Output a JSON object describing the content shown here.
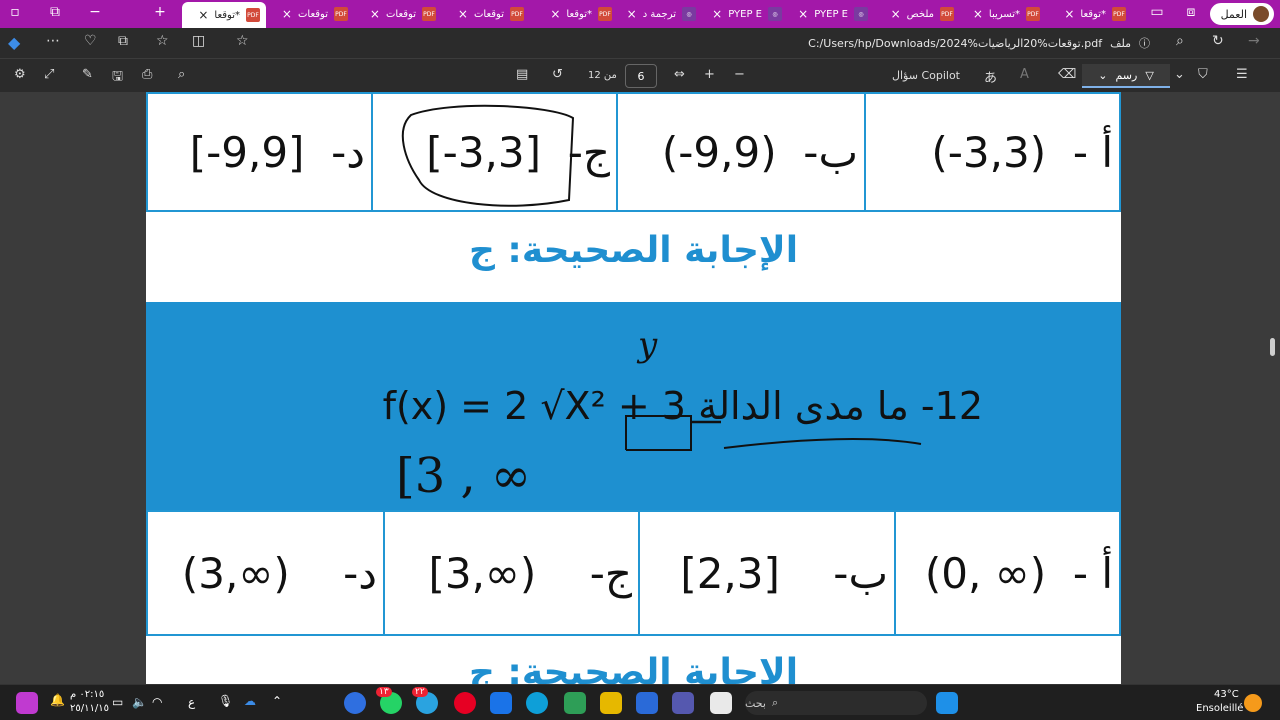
{
  "tabs": [
    {
      "label": "*توقعا",
      "active": true
    },
    {
      "label": "توقعات"
    },
    {
      "label": "توقعات"
    },
    {
      "label": "توقعات"
    },
    {
      "label": "*توقعا"
    },
    {
      "label": "ترجمة د"
    },
    {
      "label": "PYEP E"
    },
    {
      "label": "PYEP E"
    },
    {
      "label": "ملخص"
    },
    {
      "label": "*تسريبا"
    },
    {
      "label": "*توقعا"
    }
  ],
  "profile": {
    "label": "العمل"
  },
  "address": {
    "path": "C:/Users/hp/Downloads/2024%توقعات%20الرياضيات.pdf",
    "file_label": "ملف"
  },
  "pdf_toolbar": {
    "page": "6",
    "of_total": "من 12",
    "copilot": "سؤال Copilot",
    "draw": "رسم"
  },
  "document": {
    "row1": [
      {
        "label": "أ -",
        "value": "(-3,3)"
      },
      {
        "label": "ب-",
        "value": "(-9,9)"
      },
      {
        "label": "ج-",
        "value": "[-3,3]"
      },
      {
        "label": "د-",
        "value": "[-9,9]"
      }
    ],
    "answer1": "الإجابة الصحيحة: ج",
    "question": {
      "number": "12-",
      "text": "ما مدى الدالة",
      "formula": "f(x) = 2 √X² + 3"
    },
    "annotation": {
      "y": "y",
      "range": "[3 , ∞"
    },
    "row2": [
      {
        "label": "أ -",
        "value": "(0, ∞)"
      },
      {
        "label": "ب-",
        "value": "[2,3]"
      },
      {
        "label": "ج-",
        "value": "[3,∞)"
      },
      {
        "label": "د-",
        "value": "(3,∞)"
      }
    ],
    "answer2": "الإجابة الصحيحة: ج"
  },
  "taskbar": {
    "search": "بحث",
    "weather_temp": "43°C",
    "weather_desc": "Ensoleillé",
    "time": "٠٢:١٥ م",
    "date": "٢٥/١١/١٥",
    "lang": "ع",
    "badge_whatsapp": "١٣",
    "badge_pinterest": "٢٢"
  },
  "colors": {
    "tabbar": "#a318a9",
    "accent": "#1e90d0"
  }
}
